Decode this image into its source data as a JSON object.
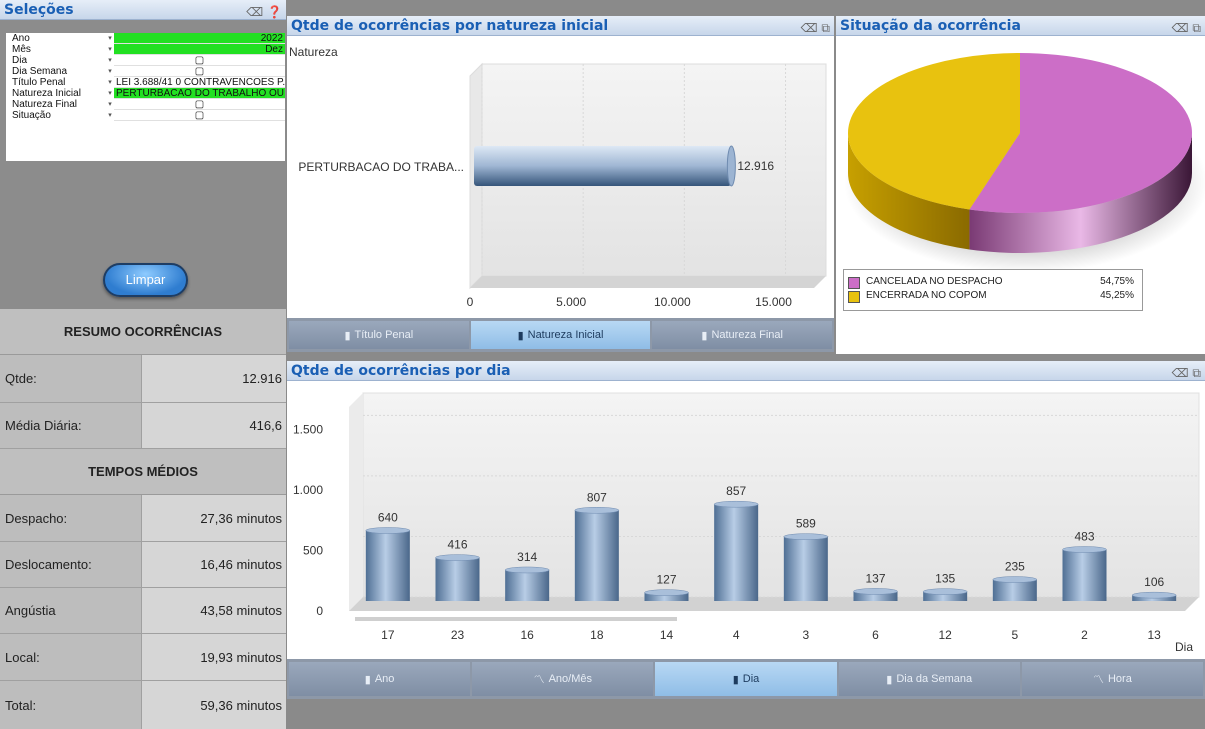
{
  "selections": {
    "title": "Seleções",
    "rows": [
      {
        "label": "Ano",
        "value": "2022"
      },
      {
        "label": "Mês",
        "value": "Dez"
      },
      {
        "label": "Dia",
        "value": "▢"
      },
      {
        "label": "Dia Semana",
        "value": "▢"
      },
      {
        "label": "Título Penal",
        "value": "LEI 3.688/41 0 CONTRAVENCOES P..."
      },
      {
        "label": "Natureza Inicial",
        "value": "PERTURBACAO DO TRABALHO OU ..."
      },
      {
        "label": "Natureza Final",
        "value": "▢"
      },
      {
        "label": "Situação",
        "value": "▢"
      }
    ],
    "clear_label": "Limpar"
  },
  "summary": {
    "resumo_title": "RESUMO OCORRÊNCIAS",
    "qtde_label": "Qtde:",
    "qtde_value": "12.916",
    "media_label": "Média Diária:",
    "media_value": "416,6",
    "tempos_title": "TEMPOS MÉDIOS",
    "despacho_label": "Despacho:",
    "despacho_value": "27,36 minutos",
    "deslocamento_label": "Deslocamento:",
    "deslocamento_value": "16,46 minutos",
    "angustia_label": "Angústia",
    "angustia_value": "43,58 minutos",
    "local_label": "Local:",
    "local_value": "19,93 minutos",
    "total_label": "Total:",
    "total_value": "59,36 minutos"
  },
  "natureza_panel": {
    "title": "Qtde de ocorrências por natureza inicial",
    "tabs": [
      "Título Penal",
      "Natureza Inicial",
      "Natureza Final"
    ],
    "active_tab": 1
  },
  "situacao_panel": {
    "title": "Situação da ocorrência"
  },
  "dia_panel": {
    "title": "Qtde de ocorrências por dia",
    "tabs": [
      "Ano",
      "Ano/Mês",
      "Dia",
      "Dia da Semana",
      "Hora"
    ],
    "active_tab": 2
  },
  "chart_data": [
    {
      "type": "bar",
      "orientation": "horizontal",
      "title": "Qtde de ocorrências por natureza inicial",
      "ylabel": "Natureza",
      "categories": [
        "PERTURBACAO DO TRABA..."
      ],
      "values": [
        12916
      ],
      "value_labels": [
        "12.916"
      ],
      "xlim": [
        0,
        17000
      ],
      "xticks": [
        0,
        5000,
        10000,
        15000
      ],
      "xtick_labels": [
        "0",
        "5.000",
        "10.000",
        "15.000"
      ]
    },
    {
      "type": "pie",
      "title": "Situação da ocorrência",
      "slices": [
        {
          "label": "CANCELADA NO DESPACHO",
          "value": 54.75,
          "value_label": "54,75%",
          "color": "#cc6ec7"
        },
        {
          "label": "ENCERRADA NO COPOM",
          "value": 45.25,
          "value_label": "45,25%",
          "color": "#e8c20f"
        }
      ],
      "legend": "bottom"
    },
    {
      "type": "bar",
      "title": "Qtde de ocorrências por dia",
      "xlabel": "Dia",
      "categories": [
        "17",
        "23",
        "16",
        "18",
        "14",
        "4",
        "3",
        "6",
        "12",
        "5",
        "2",
        "13"
      ],
      "values": [
        640,
        416,
        314,
        807,
        127,
        857,
        589,
        137,
        135,
        235,
        483,
        106
      ],
      "ylim": [
        0,
        1800
      ],
      "yticks": [
        0,
        500,
        1000,
        1500
      ],
      "ytick_labels": [
        "0",
        "500",
        "1.000",
        "1.500"
      ]
    }
  ]
}
